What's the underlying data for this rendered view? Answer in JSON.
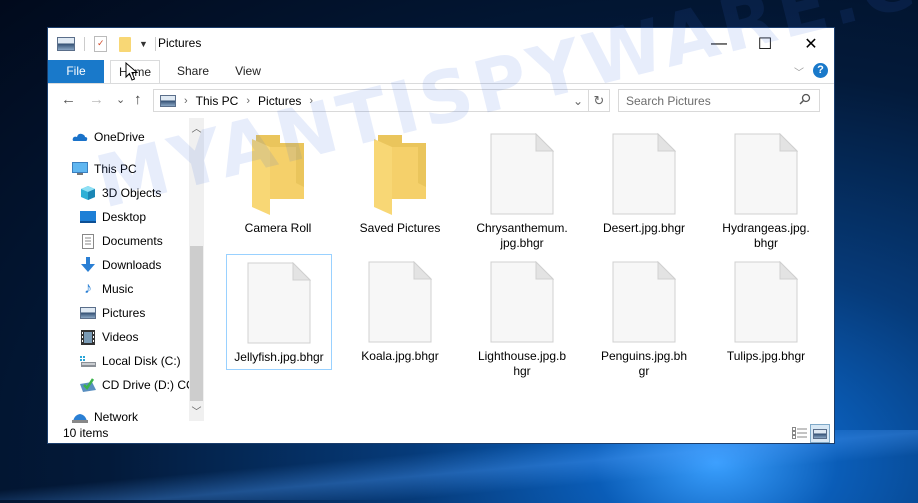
{
  "window": {
    "title": "Pictures",
    "controls": {
      "minimize": "—",
      "maximize": "☐",
      "close": "✕"
    }
  },
  "ribbon": {
    "tabs": [
      {
        "label": "File",
        "active": true
      },
      {
        "label": "Home"
      },
      {
        "label": "Share"
      },
      {
        "label": "View"
      }
    ],
    "help_label": "?"
  },
  "navigation": {
    "back": "←",
    "forward": "→",
    "recent": "⌄",
    "up": "↑",
    "breadcrumb": [
      "This PC",
      "Pictures"
    ],
    "separator": "›",
    "dropdown": "⌄",
    "refresh": "↻",
    "search_placeholder": "Search Pictures"
  },
  "sidebar": {
    "items": [
      {
        "label": "OneDrive",
        "icon": "cloud-icon",
        "level": 0
      },
      {
        "label": "This PC",
        "icon": "computer-icon",
        "level": 0
      },
      {
        "label": "3D Objects",
        "icon": "cube-icon",
        "level": 1
      },
      {
        "label": "Desktop",
        "icon": "desktop-icon",
        "level": 1
      },
      {
        "label": "Documents",
        "icon": "document-icon",
        "level": 1
      },
      {
        "label": "Downloads",
        "icon": "download-icon",
        "level": 1
      },
      {
        "label": "Music",
        "icon": "music-icon",
        "level": 1
      },
      {
        "label": "Pictures",
        "icon": "pictures-icon",
        "level": 1
      },
      {
        "label": "Videos",
        "icon": "videos-icon",
        "level": 1
      },
      {
        "label": "Local Disk (C:)",
        "icon": "disk-icon",
        "level": 1
      },
      {
        "label": "CD Drive (D:) CC",
        "icon": "cd-drive-icon",
        "level": 1
      },
      {
        "label": "Network",
        "icon": "network-icon",
        "level": 0
      }
    ]
  },
  "files": [
    {
      "name": "Camera Roll",
      "type": "folder"
    },
    {
      "name": "Saved Pictures",
      "type": "folder"
    },
    {
      "name": "Chrysanthemum.\njpg.bhgr",
      "type": "file"
    },
    {
      "name": "Desert.jpg.bhgr",
      "type": "file"
    },
    {
      "name": "Hydrangeas.jpg.\nbhgr",
      "type": "file"
    },
    {
      "name": "Jellyfish.jpg.bhgr",
      "type": "file",
      "selected": true
    },
    {
      "name": "Koala.jpg.bhgr",
      "type": "file"
    },
    {
      "name": "Lighthouse.jpg.b\nhgr",
      "type": "file"
    },
    {
      "name": "Penguins.jpg.bh\ngr",
      "type": "file"
    },
    {
      "name": "Tulips.jpg.bhgr",
      "type": "file"
    }
  ],
  "status": {
    "item_count": "10 items"
  },
  "watermark": "MYANTISPYWARE.COM",
  "colors": {
    "accent": "#1979ca",
    "folder": "#f8d775",
    "selection_border": "#99d1ff"
  }
}
